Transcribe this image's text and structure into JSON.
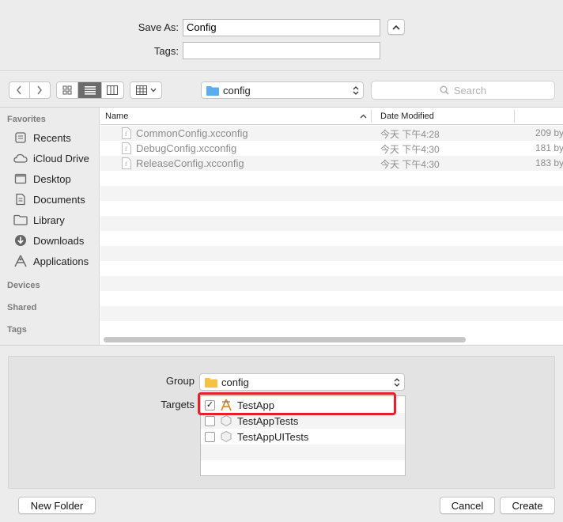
{
  "save": {
    "save_as_label": "Save As:",
    "save_as_value": "Config",
    "tags_label": "Tags:",
    "tags_value": ""
  },
  "toolbar": {
    "location": "config",
    "search_placeholder": "Search"
  },
  "sidebar": {
    "favorites_header": "Favorites",
    "items": [
      {
        "label": "Recents",
        "icon": "recents-icon"
      },
      {
        "label": "iCloud Drive",
        "icon": "cloud-icon"
      },
      {
        "label": "Desktop",
        "icon": "desktop-icon"
      },
      {
        "label": "Documents",
        "icon": "documents-icon"
      },
      {
        "label": "Library",
        "icon": "folder-icon"
      },
      {
        "label": "Downloads",
        "icon": "downloads-icon"
      },
      {
        "label": "Applications",
        "icon": "applications-icon"
      }
    ],
    "devices_header": "Devices",
    "shared_header": "Shared",
    "tags_header": "Tags"
  },
  "columns": {
    "name": "Name",
    "date_modified": "Date Modified"
  },
  "files": [
    {
      "name": "CommonConfig.xcconfig",
      "date": "今天 下午4:28",
      "size": "209 by"
    },
    {
      "name": "DebugConfig.xcconfig",
      "date": "今天 下午4:30",
      "size": "181 by"
    },
    {
      "name": "ReleaseConfig.xcconfig",
      "date": "今天 下午4:30",
      "size": "183 by"
    }
  ],
  "options": {
    "group_label": "Group",
    "group_value": "config",
    "targets_label": "Targets",
    "targets": [
      {
        "name": "TestApp",
        "checked": "✓"
      },
      {
        "name": "TestAppTests",
        "checked": ""
      },
      {
        "name": "TestAppUITests",
        "checked": ""
      }
    ]
  },
  "buttons": {
    "new_folder": "New Folder",
    "cancel": "Cancel",
    "create": "Create"
  },
  "colors": {
    "highlight": "#e5212d",
    "folder": "#5aaef0"
  }
}
